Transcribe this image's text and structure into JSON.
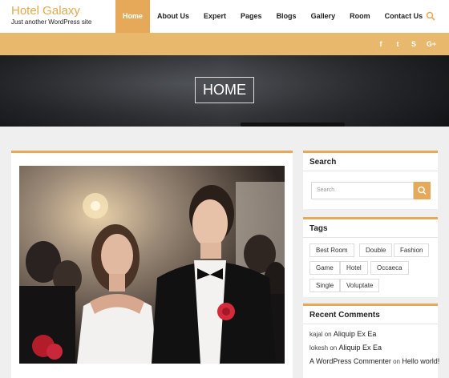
{
  "site": {
    "title": "Hotel Galaxy",
    "tagline": "Just another WordPress site"
  },
  "nav": {
    "items": [
      {
        "label": "Home",
        "active": true
      },
      {
        "label": "About Us"
      },
      {
        "label": "Expert"
      },
      {
        "label": "Pages"
      },
      {
        "label": "Blogs"
      },
      {
        "label": "Gallery"
      },
      {
        "label": "Room"
      },
      {
        "label": "Contact Us"
      }
    ],
    "search_icon": "search-icon"
  },
  "social": [
    {
      "icon": "facebook-icon",
      "glyph": "f"
    },
    {
      "icon": "twitter-icon",
      "glyph": "t"
    },
    {
      "icon": "skype-icon",
      "glyph": "S"
    },
    {
      "icon": "google-plus-icon",
      "glyph": "G+"
    }
  ],
  "hero": {
    "title": "HOME"
  },
  "sidebar": {
    "search": {
      "title": "Search",
      "placeholder": "Search"
    },
    "tags": {
      "title": "Tags",
      "items": [
        "Best Room",
        "Double",
        "Fashion",
        "Game",
        "Hotel",
        "Occaeca",
        "Single",
        "Voluptate"
      ]
    },
    "comments": {
      "title": "Recent Comments",
      "items": [
        {
          "author": "kajal",
          "on": "on",
          "post": "Aliquip Ex Ea"
        },
        {
          "author": "lokesh",
          "on": "on",
          "post": "Aliquip Ex Ea"
        },
        {
          "author": "A WordPress Commenter",
          "on": "on",
          "post": "Hello world!"
        }
      ]
    }
  },
  "colors": {
    "accent": "#e6a95a",
    "brand_title": "#e0a94e",
    "social_bar": "#e8b86c"
  }
}
